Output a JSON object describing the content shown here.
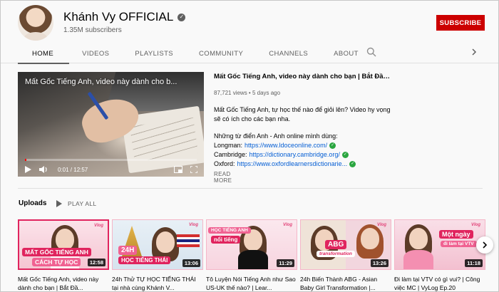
{
  "channel": {
    "name": "Khánh Vy OFFICIAL",
    "subscribers": "1.35M subscribers",
    "subscribe_label": "SUBSCRIBE"
  },
  "tabs": [
    "HOME",
    "VIDEOS",
    "PLAYLISTS",
    "COMMUNITY",
    "CHANNELS",
    "ABOUT"
  ],
  "active_tab": "HOME",
  "icons": {
    "search": "search-icon",
    "tabs_next": "chevron-right-icon",
    "verified": "verified-check-icon"
  },
  "featured": {
    "player_title": "Mất Gốc Tiếng Anh, video này dành cho b...",
    "time": "0:01 / 12:57",
    "progress": 0.0013,
    "title": "Mất Gốc Tiếng Anh, video này dành cho bạn | Bắt Đầu từ đâ...",
    "meta": "87,721 views • 5 days ago",
    "desc_intro": "Mất Gốc Tiếng Anh, tự học thế nào để giỏi lên? Video hy vọng sẽ có ích cho các bạn nha.",
    "desc_dict_heading": "Những từ điển Anh - Anh online mình dùng:",
    "dictionaries": [
      {
        "label": "Longman:",
        "link": "https://www.ldoceonline.com/"
      },
      {
        "label": "Cambridge:",
        "link": "https://dictionary.cambridge.org/"
      },
      {
        "label": "Oxford:",
        "link": "https://www.oxfordlearnersdictionarie..."
      }
    ],
    "read_more": "READ MORE"
  },
  "shelf": {
    "title": "Uploads",
    "play_all": "PLAY ALL",
    "videos": [
      {
        "title": "Mất Gốc Tiếng Anh, video này dành cho bạn | Bắt Đầ...",
        "duration": "12:58",
        "caption_top": "MẤT GỐC TIẾNG ANH",
        "caption_bottom": "CÁCH TỰ HỌC",
        "tag": "Vlog"
      },
      {
        "title": "24h Thử TỰ HỌC TIẾNG THÁI tại nhà cùng Khánh V...",
        "duration": "13:06",
        "caption_top": "24H",
        "caption_bottom": "HỌC TIẾNG THÁI",
        "tag": "Vlog"
      },
      {
        "title": "Tô Luyện Nói Tiếng Anh như Sao US-UK thế nào? | Lear...",
        "duration": "11:29",
        "caption_top": "HỌC TIẾNG ANH",
        "caption_bottom": "nổi tiếng",
        "tag": "Vlog"
      },
      {
        "title": "24h Biến Thành ABG - Asian Baby Girl Transformation |...",
        "duration": "13:26",
        "caption_top": "ABG",
        "caption_bottom": "transformation",
        "tag": "Vlog"
      },
      {
        "title": "Đi làm tại VTV có gì vui? | Công việc MC | VyLog Ep.20",
        "duration": "11:18",
        "caption_top": "Một ngày",
        "caption_bottom": "đi làm tại VTV",
        "tag": "Vlog"
      }
    ]
  },
  "colors": {
    "accent_red": "#cc0000",
    "link_blue": "#065fd4",
    "check_green": "#2ba640",
    "thumb_pink": "#f7d9e3",
    "selected_border": "#e0245e"
  }
}
